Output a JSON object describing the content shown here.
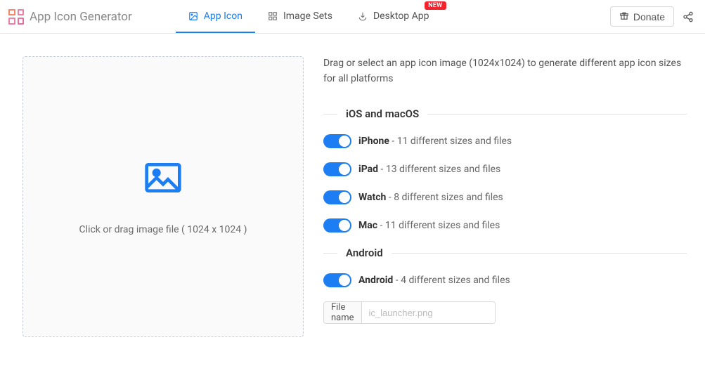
{
  "header": {
    "title": "App Icon Generator",
    "nav": [
      {
        "label": "App Icon",
        "icon": "image-icon"
      },
      {
        "label": "Image Sets",
        "icon": "grid-icon"
      },
      {
        "label": "Desktop App",
        "icon": "download-icon",
        "badge": "NEW"
      }
    ],
    "donate_label": "Donate"
  },
  "dropzone": {
    "text": "Click or drag image file ( 1024 x 1024 )"
  },
  "intro": "Drag or select an app icon image (1024x1024) to generate different app icon sizes for all platforms",
  "sections": {
    "ios_macos": {
      "heading": "iOS and macOS",
      "items": [
        {
          "name": "iPhone",
          "desc": " - 11 different sizes and files"
        },
        {
          "name": "iPad",
          "desc": " - 13 different sizes and files"
        },
        {
          "name": "Watch",
          "desc": " - 8 different sizes and files"
        },
        {
          "name": "Mac",
          "desc": " - 11 different sizes and files"
        }
      ]
    },
    "android": {
      "heading": "Android",
      "items": [
        {
          "name": "Android",
          "desc": " - 4 different sizes and files"
        }
      ],
      "filename_label": "File name",
      "filename_placeholder": "ic_launcher.png"
    }
  }
}
